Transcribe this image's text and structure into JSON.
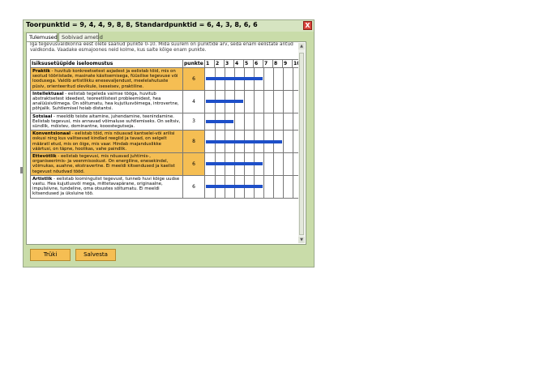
{
  "window": {
    "title": "Toorpunktid = 9, 4, 4, 9, 8, 8, Standardpunktid = 6, 4, 3, 8, 6, 6",
    "close": "X"
  },
  "tabs": [
    {
      "label": "Tulemused"
    },
    {
      "label": "Sobivad ametid"
    }
  ],
  "intro": "Iga tegevusvaldkonna eest olete saanud punkte 0-10. Mida suurem on punktide arv, seda enam eelistate antud valdkonda. Vaadake esmajoones neid kolme, kus saite kõige enam punkte.",
  "table": {
    "headers": {
      "type": "Isiksusetüüpide iseloomustus",
      "points": "punkte",
      "scale": [
        "1",
        "2",
        "3",
        "4",
        "5",
        "6",
        "7",
        "8",
        "9",
        "10"
      ]
    },
    "max": 10,
    "rows": [
      {
        "name": "Praktik",
        "text": " - huvitub konkreetsetest asjadest ja eelistab töid, mis on seotud tööriistade, masinate käsitsemisega, füüsilise tegevuse või loodusega. Valdib artistlikku enesevaljendust, meelelahutuste püsiv, orienteeritud olevikule, iseseisev, praktiline.",
        "points": "6",
        "value": 6,
        "highlight": true
      },
      {
        "name": "Intellektuaal",
        "text": " - eelistab tegeleda vaimse tööga, huvitub abstraktsetest ideedest, teoreetilistest probleemidest, hea analüüsivõimega. On sõltumatu, hea kujutlusvõimega, introvertne, põhjalik. Suhtlemisel hoiab distantsi.",
        "points": "4",
        "value": 4,
        "highlight": false
      },
      {
        "name": "Sotsiaal",
        "text": " - meeldib teiste aitamine, juhendamine, teenindamine. Eelistab tegevusi, mis annavad võimaluse suhtlemiseks. On seltsiv, sündlik, mõistev, dominantne, kooostegutseja.",
        "points": "3",
        "value": 3,
        "highlight": false
      },
      {
        "name": "Konventsionaal",
        "text": " - eelistab töid, mis nõuavad kantselei-või arilisi oskusi ning kus valitsevad kindlad reeglid ja tavad, on selgelt määratl etud, mis on õige, mis vaar. Hindab majanduslikke väärtusi, on täpne, hoolikas, vahe paindlik.",
        "points": "8",
        "value": 8,
        "highlight": true
      },
      {
        "name": "Ettevõtlik",
        "text": " - eelistab tegevusi, mis nõuavad juhtimis-, organiseerimis- ja veenmisoskust. On energiline, enesekindel, võimukas, auahne, ekstravertne. Ei meeldi kitsendused ja kaelist tegevust nõudvad tööd.",
        "points": "6",
        "value": 6,
        "highlight": true
      },
      {
        "name": "Artistlik",
        "text": " - eelistab loomingulist tegevust, tunneb huvi kõige uudse vastu. Hea kujutlusvõi mega, mittetavapärane, originaalne, impulsiivne, tundeline, oma otsustes sõltumatu. Ei meeldi kitsendused ja üksluine töö.",
        "points": "6",
        "value": 6,
        "highlight": false
      }
    ]
  },
  "buttons": {
    "print": "Trüki",
    "save": "Salvesta"
  },
  "colors": {
    "highlight": "#f5be53",
    "bar": "#1e4fc8",
    "frame": "#c9dca9"
  }
}
